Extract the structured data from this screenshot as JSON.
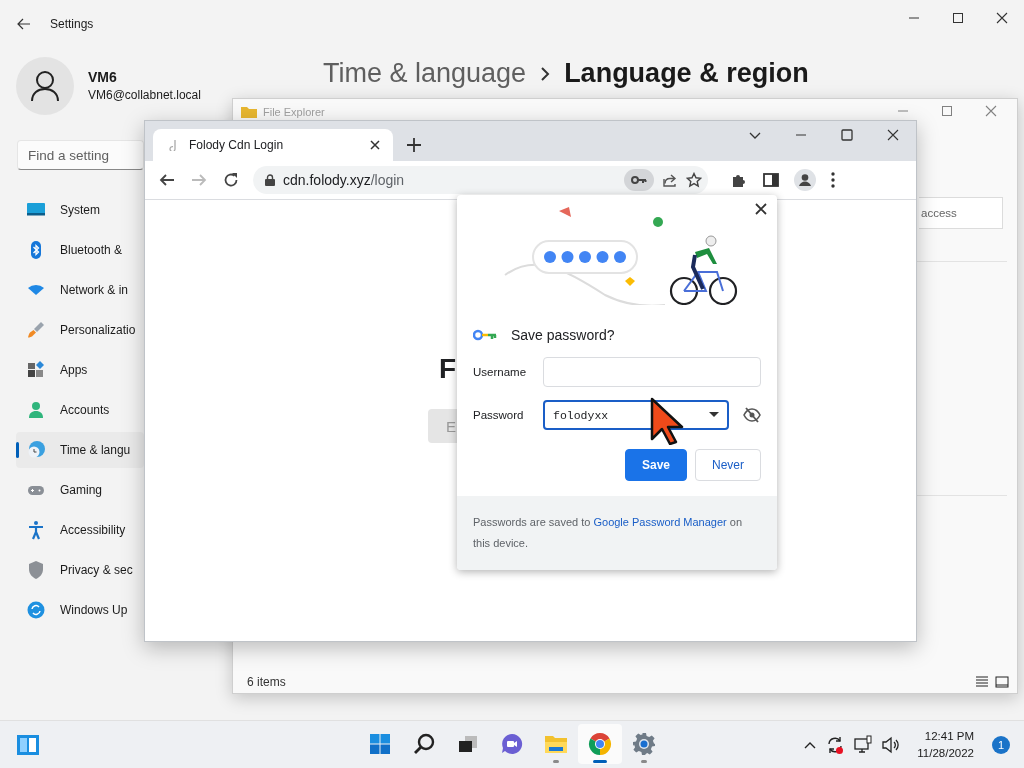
{
  "settings": {
    "title": "Settings",
    "user": {
      "name": "VM6",
      "email": "VM6@collabnet.local"
    },
    "breadcrumb": [
      {
        "text": "Time & language"
      },
      {
        "text": "Language & region"
      }
    ],
    "search": {
      "placeholder": "Find a setting"
    },
    "nav": [
      {
        "kind": "system",
        "label": "System",
        "selected": false
      },
      {
        "kind": "bluetooth",
        "label": "Bluetooth &",
        "selected": false
      },
      {
        "kind": "network",
        "label": "Network & in",
        "selected": false
      },
      {
        "kind": "personalization",
        "label": "Personalizatio",
        "selected": false
      },
      {
        "kind": "apps",
        "label": "Apps",
        "selected": false
      },
      {
        "kind": "accounts",
        "label": "Accounts",
        "selected": false
      },
      {
        "kind": "time",
        "label": "Time & langu",
        "selected": true
      },
      {
        "kind": "gaming",
        "label": "Gaming",
        "selected": false
      },
      {
        "kind": "accessibility",
        "label": "Accessibility",
        "selected": false
      },
      {
        "kind": "privacy",
        "label": "Privacy & sec",
        "selected": false
      },
      {
        "kind": "update",
        "label": "Windows Up",
        "selected": false
      }
    ]
  },
  "file_explorer": {
    "title": "File Explorer",
    "search": {
      "placeholder": "access"
    },
    "status": "6 items"
  },
  "browser": {
    "tab": {
      "title": "Folody Cdn Login"
    },
    "url": {
      "domain": "cdn.folody.xyz",
      "path": "/login"
    },
    "key_icon_active": true,
    "page": {
      "heading": "F",
      "button": "E"
    }
  },
  "password_dialog": {
    "title": "Save password?",
    "username": {
      "label": "Username"
    },
    "password": {
      "label": "Password",
      "value": "folodyxx"
    },
    "buttons": [
      {
        "label": "Save",
        "kind": "primary"
      },
      {
        "label": "Never",
        "kind": "secondary"
      }
    ],
    "footer": {
      "before": "Passwords are saved to ",
      "link": "Google Password Manager",
      "after": " on this device."
    }
  },
  "taskbar": {
    "apps": [
      {
        "kind": "start",
        "selected": false,
        "running": false
      },
      {
        "kind": "search",
        "selected": false,
        "running": false
      },
      {
        "kind": "taskview",
        "selected": false,
        "running": false
      },
      {
        "kind": "chat",
        "selected": false,
        "running": false
      },
      {
        "kind": "explorer",
        "selected": false,
        "running": true
      },
      {
        "kind": "chrome",
        "selected": true,
        "running": true
      },
      {
        "kind": "settings",
        "selected": false,
        "running": true
      }
    ],
    "clock": {
      "time": "12:41 PM",
      "date": "11/28/2022"
    },
    "notifications": "1"
  }
}
